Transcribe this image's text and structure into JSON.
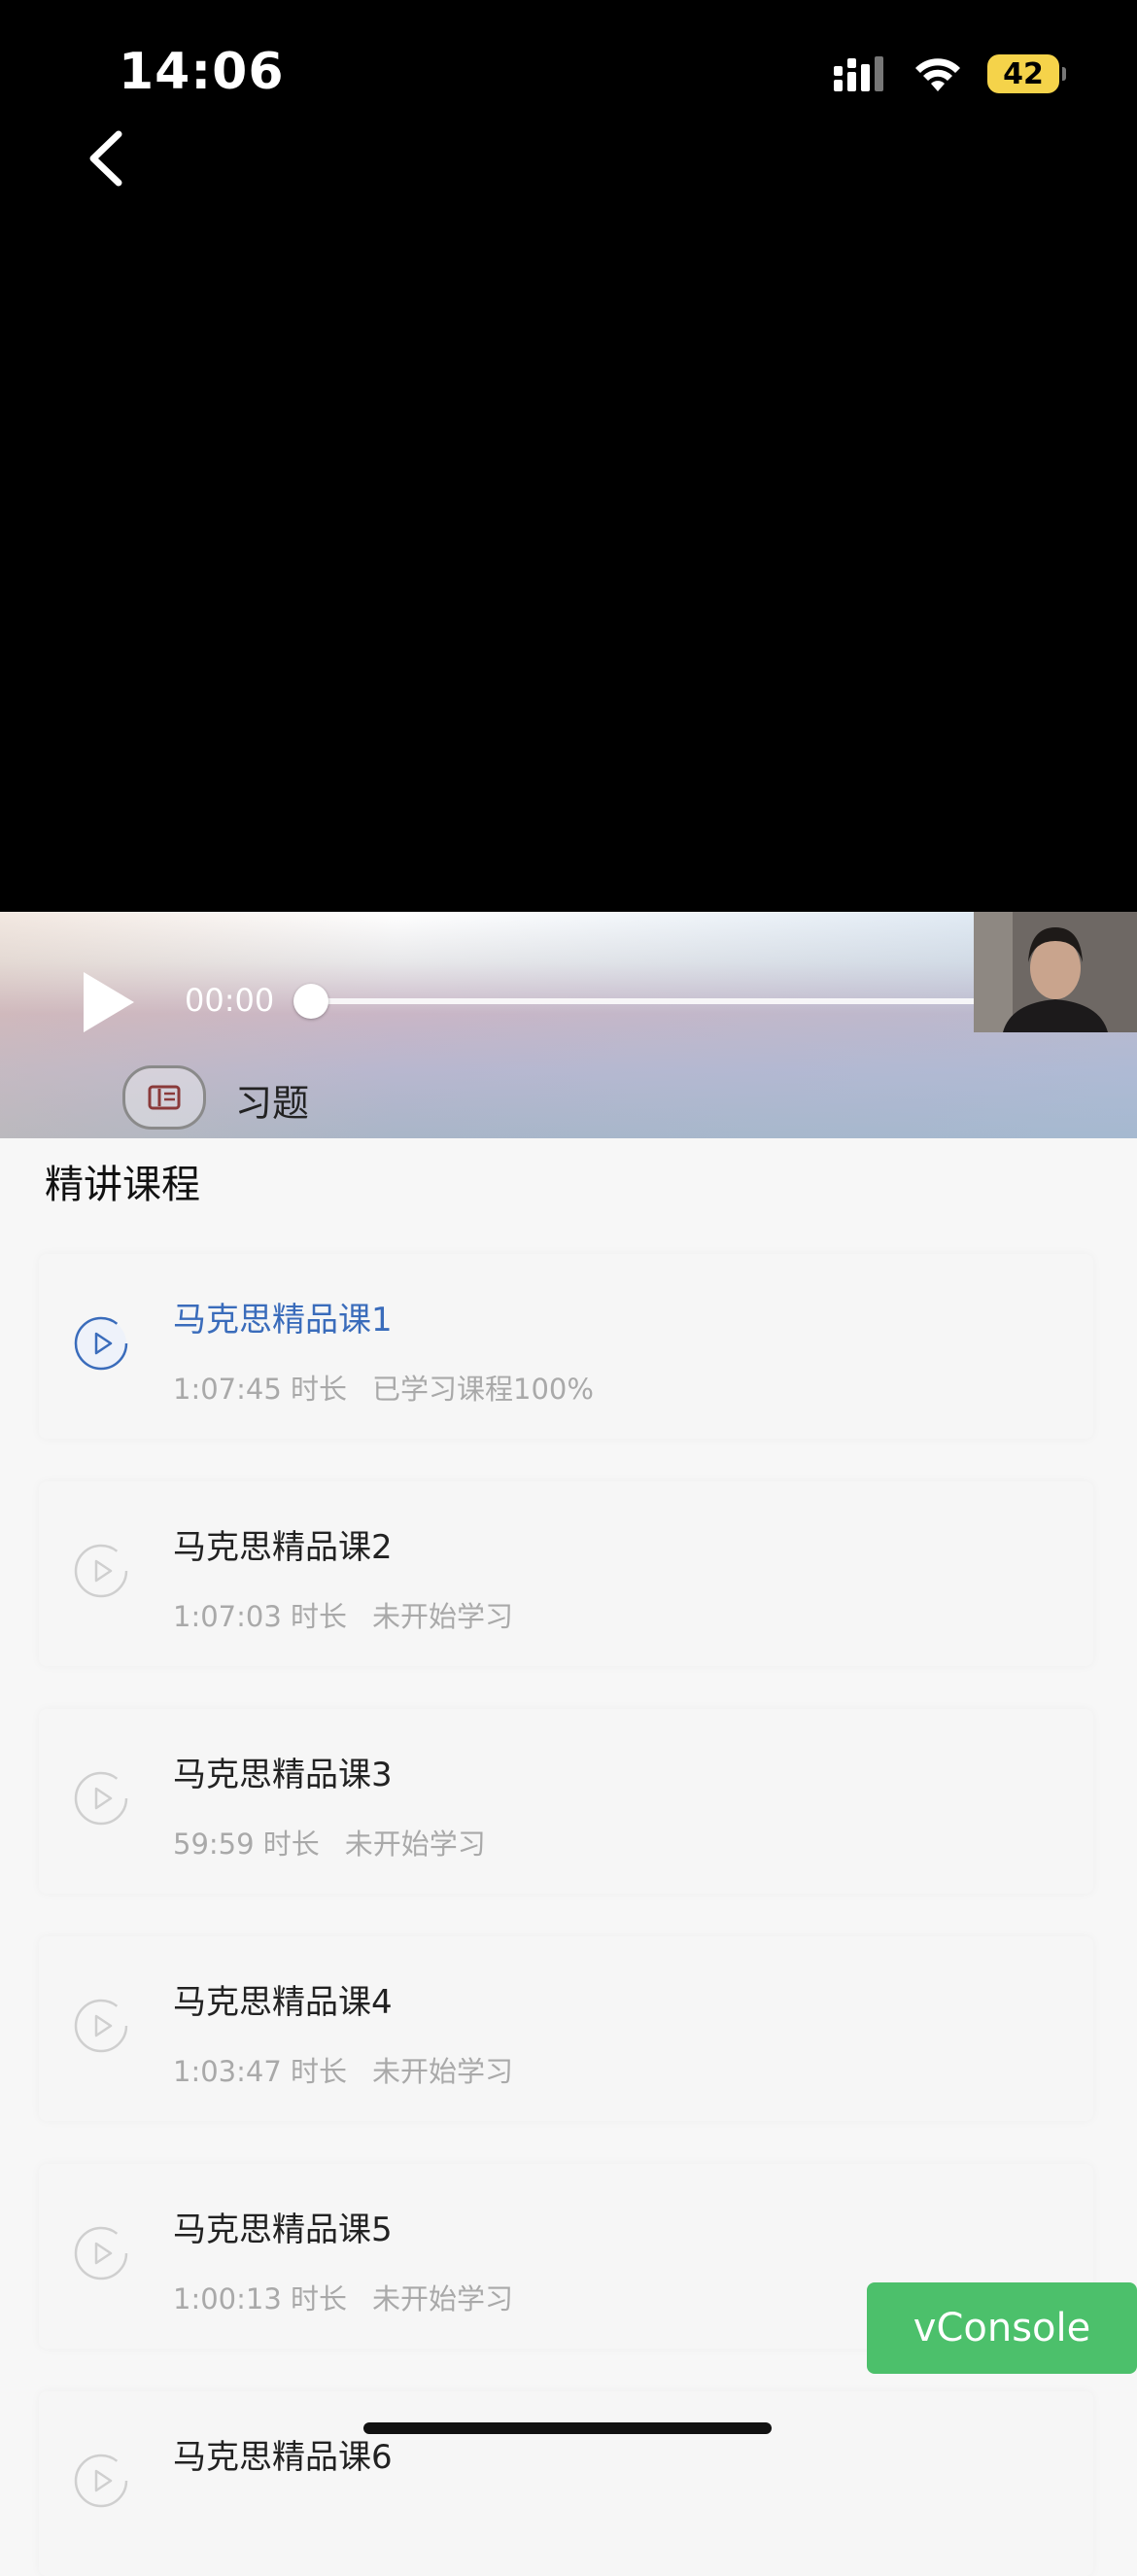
{
  "status_bar": {
    "time": "14:06",
    "battery": "42"
  },
  "player": {
    "current_time": "00:00",
    "progress": 0,
    "exercise_label": "习题"
  },
  "section": {
    "title": "精讲课程"
  },
  "courses": [
    {
      "title": "马克思精品课1",
      "duration": "1:07:45 时长",
      "status": "已学习课程100%",
      "active": true
    },
    {
      "title": "马克思精品课2",
      "duration": "1:07:03 时长",
      "status": "未开始学习",
      "active": false
    },
    {
      "title": "马克思精品课3",
      "duration": "59:59 时长",
      "status": "未开始学习",
      "active": false
    },
    {
      "title": "马克思精品课4",
      "duration": "1:03:47 时长",
      "status": "未开始学习",
      "active": false
    },
    {
      "title": "马克思精品课5",
      "duration": "1:00:13 时长",
      "status": "未开始学习",
      "active": false
    },
    {
      "title": "马克思精品课6"
    }
  ],
  "vconsole": {
    "label": "vConsole"
  },
  "colors": {
    "active": "#3a6cbb",
    "inactive_icon": "#cfcfcf",
    "vconsole": "#4cc06b"
  }
}
